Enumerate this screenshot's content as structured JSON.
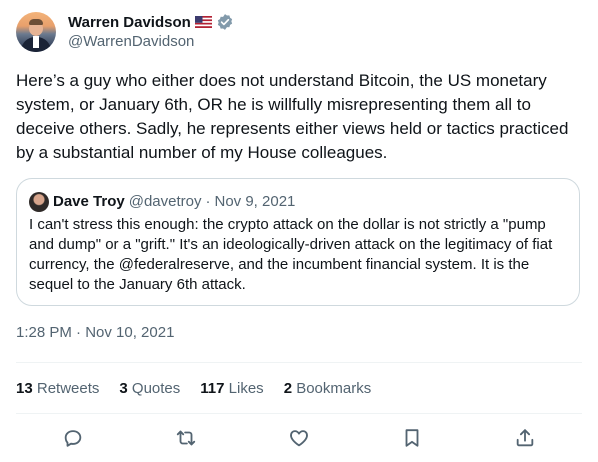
{
  "author": {
    "name": "Warren Davidson",
    "handle": "@WarrenDavidson"
  },
  "tweet": {
    "text": "Here’s a guy who either does not understand Bitcoin, the US monetary system, or January 6th, OR he is willfully misrepresenting them all to deceive others. Sadly, he represents either views held or tactics practiced by a substantial number of my House colleagues."
  },
  "quote": {
    "name": "Dave Troy",
    "handle": "@davetroy",
    "separator": "·",
    "date": "Nov 9, 2021",
    "text": "I can't stress this enough: the crypto attack on the dollar is not strictly a \"pump and dump\" or a \"grift.\" It's an ideologically-driven attack on the legitimacy of fiat currency, the @federalreserve, and the incumbent financial system. It is the sequel to the January 6th attack."
  },
  "timestamp": "1:28 PM · Nov 10, 2021",
  "stats": {
    "retweets": {
      "count": "13",
      "label": "Retweets"
    },
    "quotes": {
      "count": "3",
      "label": "Quotes"
    },
    "likes": {
      "count": "117",
      "label": "Likes"
    },
    "bookmarks": {
      "count": "2",
      "label": "Bookmarks"
    }
  },
  "icons": {
    "verified": "verified-badge-icon",
    "flag": "us-flag-icon",
    "reply": "reply-icon",
    "retweet": "retweet-icon",
    "like": "heart-icon",
    "bookmark": "bookmark-icon",
    "share": "share-icon"
  },
  "colors": {
    "text": "#0f1419",
    "secondary": "#536471",
    "border": "#cfd9de",
    "verified": "#829aab"
  }
}
